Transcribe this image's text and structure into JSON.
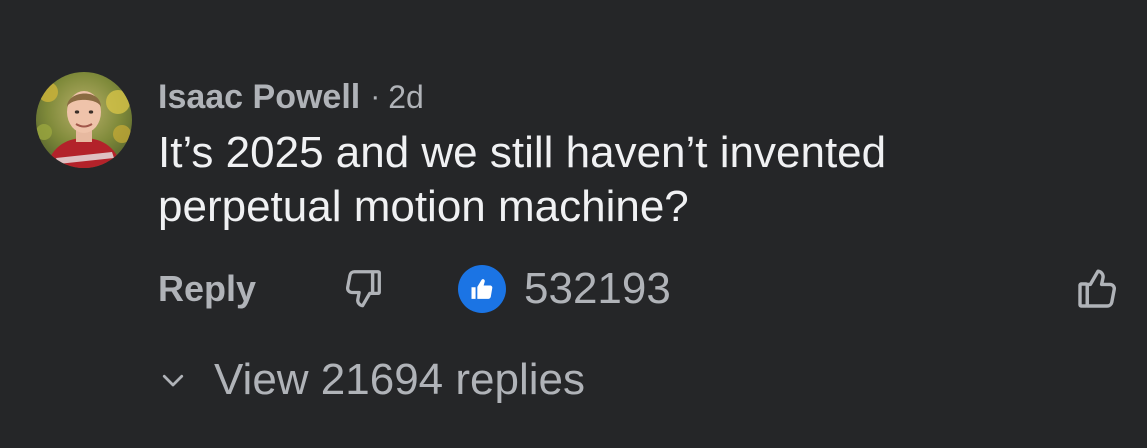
{
  "comment": {
    "author": "Isaac Powell",
    "separator": "·",
    "time": "2d",
    "text": "It’s 2025 and we still haven’t invented perpetual motion machine?",
    "avatar_icon": "user-avatar"
  },
  "actions": {
    "reply_label": "Reply",
    "dislike_icon": "thumbs-down-icon",
    "reaction_icon": "like-reaction-icon",
    "like_count": "532193",
    "like_icon": "thumbs-up-icon"
  },
  "replies": {
    "view_label": "View 21694 replies",
    "chevron_icon": "chevron-down-icon"
  },
  "colors": {
    "background": "#252628",
    "muted_text": "#b0b3b8",
    "primary_text": "#f0f1f3",
    "like_blue": "#1b74e4"
  }
}
